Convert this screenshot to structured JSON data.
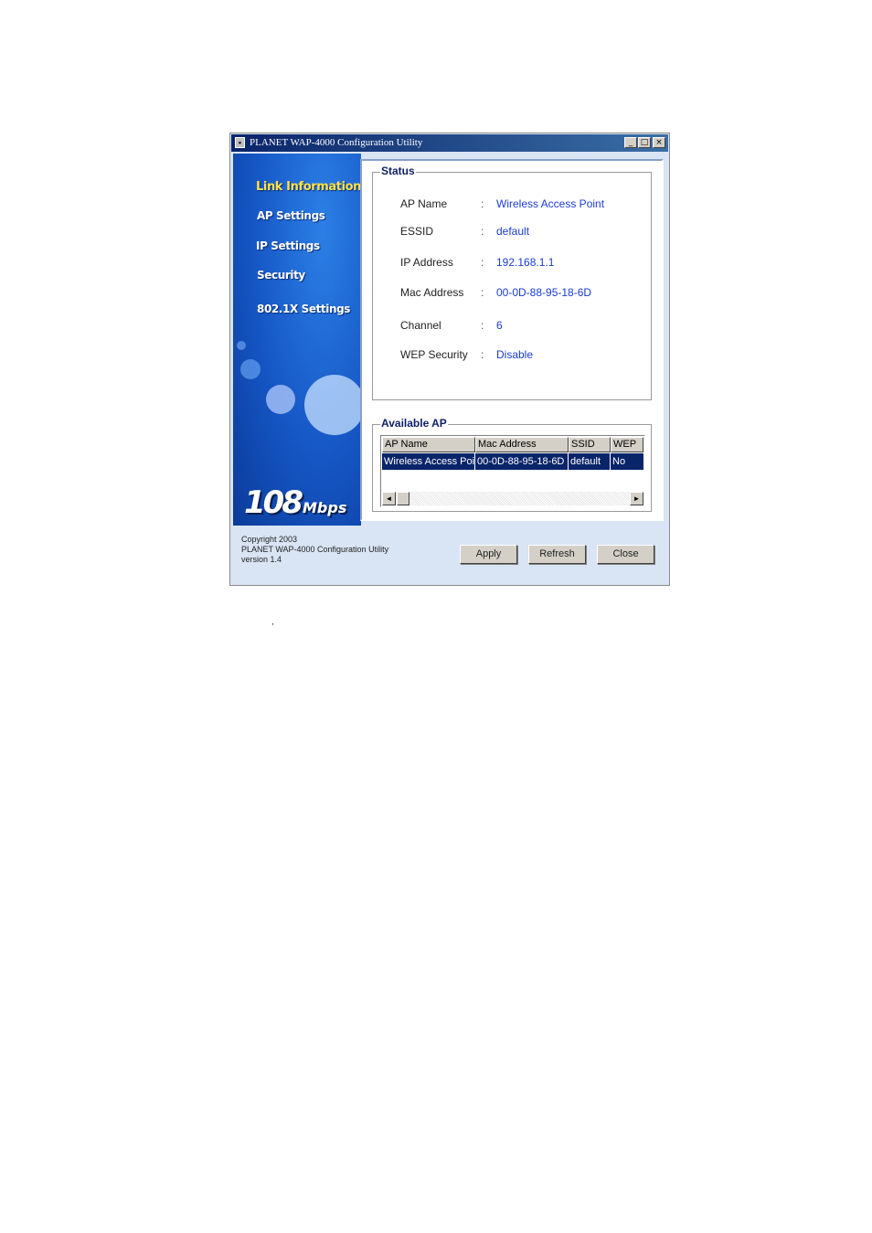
{
  "window": {
    "title": "PLANET WAP-4000 Configuration Utility",
    "icon": "app-icon",
    "controls": {
      "minimize": "_",
      "maximize": "□",
      "close": "×"
    }
  },
  "sidebar": {
    "items": [
      {
        "label": "Link Information",
        "active": true
      },
      {
        "label": "AP Settings"
      },
      {
        "label": "IP Settings"
      },
      {
        "label": "Security"
      },
      {
        "label": "802.1X Settings"
      }
    ],
    "speed_number": "108",
    "speed_unit": "Mbps",
    "accent_color": "#ffe24a"
  },
  "status": {
    "legend": "Status",
    "rows": [
      {
        "label": "AP Name",
        "sep": ":",
        "value": "Wireless Access Point"
      },
      {
        "label": "ESSID",
        "sep": ":",
        "value": "default"
      },
      {
        "label": "IP Address",
        "sep": ":",
        "value": "192.168.1.1"
      },
      {
        "label": "Mac Address",
        "sep": ":",
        "value": "00-0D-88-95-18-6D"
      },
      {
        "label": "Channel",
        "sep": ":",
        "value": "6"
      },
      {
        "label": "WEP Security",
        "sep": ":",
        "value": "Disable"
      }
    ],
    "value_color": "#1a3bd6"
  },
  "available_ap": {
    "legend": "Available AP",
    "columns": [
      "AP Name",
      "Mac Address",
      "SSID",
      "WEP"
    ],
    "rows": [
      [
        "Wireless Access Point",
        "00-0D-88-95-18-6D",
        "default",
        "No"
      ]
    ],
    "selection_color": "#0a246a",
    "scroll_left": "◄",
    "scroll_right": "►"
  },
  "footer": {
    "copyright": "Copyright 2003",
    "product": "PLANET WAP-4000 Configuration Utility",
    "version": "version 1.4",
    "buttons": {
      "apply": "Apply",
      "refresh": "Refresh",
      "close": "Close"
    }
  },
  "stray_mark": ","
}
